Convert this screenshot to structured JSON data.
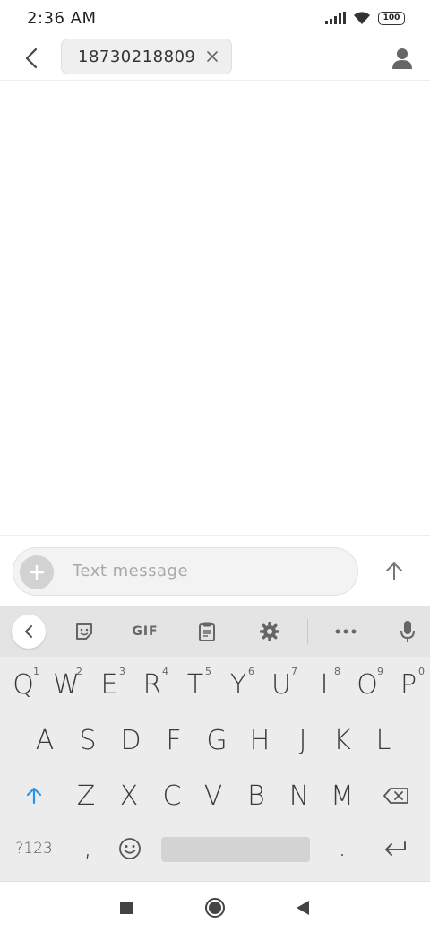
{
  "status_bar": {
    "time": "2:36 AM",
    "battery": "100",
    "icons": [
      "signal-icon",
      "wifi-icon",
      "battery-icon"
    ]
  },
  "header": {
    "recipient": "18730218809",
    "icons": [
      "back-arrow-icon",
      "close-icon",
      "contact-icon"
    ]
  },
  "compose": {
    "placeholder": "Text message",
    "icons": [
      "plus-icon",
      "send-arrow-icon"
    ]
  },
  "keyboard": {
    "toolbar": {
      "gif_label": "GIF",
      "icons": [
        "collapse-icon",
        "sticker-icon",
        "clipboard-icon",
        "settings-icon",
        "more-icon",
        "microphone-icon"
      ]
    },
    "row1": [
      {
        "key": "Q",
        "hint": "1"
      },
      {
        "key": "W",
        "hint": "2"
      },
      {
        "key": "E",
        "hint": "3"
      },
      {
        "key": "R",
        "hint": "4"
      },
      {
        "key": "T",
        "hint": "5"
      },
      {
        "key": "Y",
        "hint": "6"
      },
      {
        "key": "U",
        "hint": "7"
      },
      {
        "key": "I",
        "hint": "8"
      },
      {
        "key": "O",
        "hint": "9"
      },
      {
        "key": "P",
        "hint": "0"
      }
    ],
    "row2": [
      "A",
      "S",
      "D",
      "F",
      "G",
      "H",
      "J",
      "K",
      "L"
    ],
    "row3": [
      "Z",
      "X",
      "C",
      "V",
      "B",
      "N",
      "M"
    ],
    "row4": {
      "symbols": "?123",
      "comma": ",",
      "period": "."
    },
    "accent_color": "#2196f3"
  },
  "nav_bar": {
    "icons": [
      "recents-icon",
      "home-icon",
      "back-icon"
    ]
  }
}
